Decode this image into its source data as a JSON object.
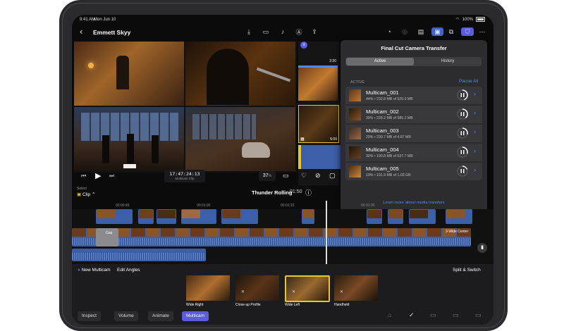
{
  "status_bar": {
    "time": "9:41 AM",
    "date": "Mon Jun 10",
    "battery": "100%"
  },
  "project": {
    "title": "Emmett Skyy"
  },
  "icons": {
    "back": "chevron-left-icon",
    "export": "share-icon",
    "camera": "camera-icon",
    "mic": "microphone-icon",
    "pen": "pen-icon",
    "upload": "upload-icon"
  },
  "viewer": {
    "timecode": "17:47:24:13",
    "timecode_label": "Multicam Clip",
    "zoom": "37",
    "zoom_unit": "%"
  },
  "browser": {
    "thumb1_time": "2:20",
    "thumb2_time": "5:09"
  },
  "transfer_panel": {
    "title": "Final Cut Camera Transfer",
    "tabs": [
      "Active",
      "History"
    ],
    "section_label": "ACTIVE",
    "pause_all": "Pause All",
    "items": [
      {
        "name": "Multicam_001",
        "detail": "44% • 232.8 MB of 529.9 MB",
        "progress": 0.44
      },
      {
        "name": "Multicam_002",
        "detail": "39% • 228.2 MB of 585.2 MB",
        "progress": 0.39
      },
      {
        "name": "Multicam_003",
        "detail": "29% • 230.7 MB of 4.87 MB",
        "progress": 0.29
      },
      {
        "name": "Multicam_004",
        "detail": "30% • 190.8 MB of 637.7 MB",
        "progress": 0.3
      },
      {
        "name": "Multicam_005",
        "detail": "19% • 191.9 MB of 1.03 GB",
        "progress": 0.19
      }
    ],
    "learn_more": "Learn more about media transfers"
  },
  "timeline": {
    "select_label": "Select",
    "select_value": "Clip",
    "project_name": "Thunder Rolling",
    "duration": "01:50",
    "ruler": [
      "00:00:45",
      "00:01:00",
      "00:01:15",
      "00:01:30"
    ],
    "gap_label": "Gap",
    "angle_clip_label": "3-Wide Center"
  },
  "multicam_bar": {
    "new_multicam": "New Multicam",
    "edit_angles": "Edit Angles",
    "split_switch": "Split & Switch",
    "angles": [
      "Wide Right",
      "Close-up Profile",
      "Wide Left",
      "Handheld"
    ],
    "active_angle": 2
  },
  "bottom_tabs": [
    "Inspect",
    "Volume",
    "Animate",
    "Multicam"
  ],
  "colors": {
    "accent": "#4a8cff",
    "selected_yellow": "#e8c630",
    "clip_blue": "#3d5ea8",
    "active_tab": "#5b5ce0"
  }
}
